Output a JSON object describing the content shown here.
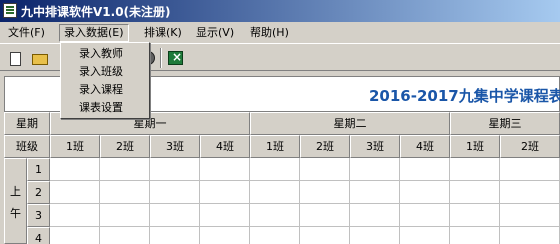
{
  "window": {
    "title": "九中排课软件V1.0(未注册)"
  },
  "menu": {
    "items": [
      {
        "key": "file",
        "label": "文件(F)"
      },
      {
        "key": "input",
        "label": "录入数据(E)"
      },
      {
        "key": "schedule",
        "label": "排课(K)"
      },
      {
        "key": "view",
        "label": "显示(V)"
      },
      {
        "key": "help",
        "label": "帮助(H)"
      }
    ],
    "dropdown": [
      "录入教师",
      "录入班级",
      "录入课程",
      "课表设置"
    ]
  },
  "toolbar": {
    "buttons": [
      "new-icon",
      "open-icon",
      "settings-icon",
      "excel-icon"
    ]
  },
  "sheet": {
    "title": "2016-2017九集中学课程表",
    "header": {
      "weekday_label": "星期",
      "class_label": "班级",
      "days": [
        "星期一",
        "星期二",
        "星期三"
      ],
      "classes": [
        "1班",
        "2班",
        "3班",
        "4班",
        "1班",
        "2班",
        "3班",
        "4班",
        "1班",
        "2班"
      ]
    },
    "period_group": {
      "char1": "上",
      "char2": "午"
    },
    "periods": [
      "1",
      "2",
      "3",
      "4"
    ]
  }
}
